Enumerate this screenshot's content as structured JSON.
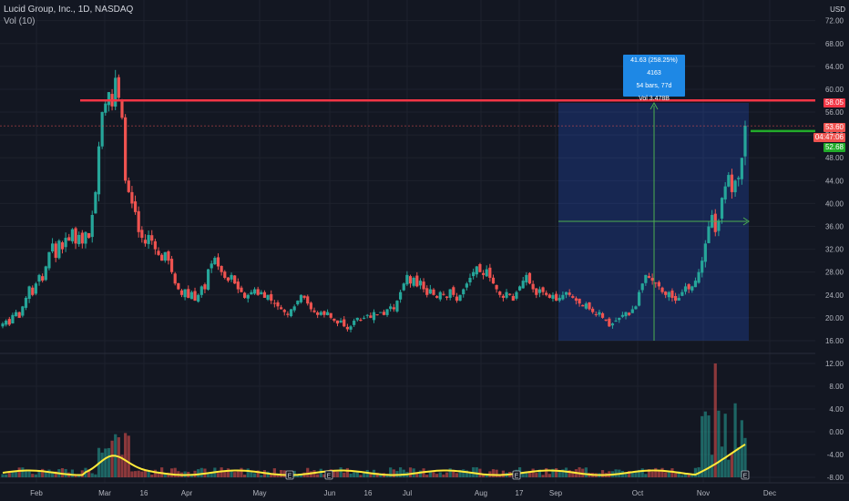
{
  "header": {
    "symbol_line": "Lucid Group, Inc., 1D, NASDAQ",
    "indicator": "Vol (10)",
    "currency": "USD"
  },
  "measure": {
    "line1": "41.63 (258.25%) 4163",
    "line2": "54 bars, 77d",
    "line3": "Vol 3.478B"
  },
  "price_tags": {
    "resistance": "58.05",
    "last": "53.60",
    "countdown": "04:47:06",
    "target": "52.68"
  },
  "chart_data": {
    "type": "candlestick",
    "price_axis_ticks": [
      "72.00",
      "68.00",
      "64.00",
      "60.00",
      "56.00",
      "52.00",
      "48.00",
      "44.00",
      "40.00",
      "36.00",
      "32.00",
      "28.00",
      "24.00",
      "20.00",
      "16.00"
    ],
    "volume_axis_ticks": [
      "12.00",
      "8.00",
      "4.00",
      "0.00",
      "-4.00",
      "-8.00"
    ],
    "x_ticks": [
      "Feb",
      "Mar",
      "16",
      "Apr",
      "May",
      "Jun",
      "16",
      "Jul",
      "Aug",
      "17",
      "Sep",
      "Oct",
      "Nov",
      "Dec"
    ],
    "ylim_price": [
      15,
      74
    ],
    "earnings_markers": [
      "E",
      "E",
      "E",
      "E"
    ],
    "horizontal_levels": {
      "resistance": 58.05,
      "target": 52.68
    },
    "closes": [
      19.0,
      19.5,
      18.8,
      20.5,
      21.0,
      20.0,
      22.0,
      23.5,
      25.5,
      24.0,
      26.0,
      27.5,
      26.5,
      29.0,
      31.5,
      33.0,
      30.5,
      33.5,
      32.0,
      34.0,
      33.5,
      35.5,
      33.0,
      34.5,
      33.0,
      35.0,
      34.0,
      38.0,
      42.0,
      50.0,
      56.0,
      57.5,
      59.5,
      57.0,
      62.0,
      58.5,
      55.0,
      44.0,
      42.0,
      40.0,
      38.5,
      35.0,
      34.0,
      33.0,
      34.5,
      33.5,
      32.0,
      31.0,
      30.0,
      31.5,
      30.0,
      28.0,
      26.0,
      25.0,
      24.0,
      25.0,
      23.5,
      24.5,
      23.0,
      24.0,
      25.5,
      25.0,
      28.5,
      29.5,
      30.5,
      29.0,
      28.0,
      27.0,
      26.5,
      27.5,
      26.0,
      25.0,
      24.5,
      23.5,
      24.0,
      24.5,
      25.0,
      24.0,
      24.5,
      23.5,
      24.0,
      23.0,
      22.5,
      22.0,
      21.5,
      21.0,
      20.5,
      21.5,
      22.0,
      23.0,
      24.0,
      23.5,
      22.5,
      21.5,
      21.0,
      20.5,
      21.0,
      20.5,
      21.0,
      20.0,
      19.5,
      19.0,
      19.5,
      18.5,
      18.0,
      18.5,
      19.5,
      20.0,
      19.5,
      20.0,
      20.5,
      20.0,
      21.0,
      20.5,
      21.0,
      20.5,
      21.5,
      22.0,
      21.5,
      23.0,
      24.5,
      26.0,
      27.5,
      26.0,
      27.0,
      25.5,
      26.5,
      25.0,
      24.0,
      25.0,
      24.0,
      23.5,
      24.5,
      24.0,
      23.5,
      25.0,
      24.0,
      23.0,
      24.0,
      25.0,
      26.0,
      27.0,
      28.0,
      29.0,
      28.0,
      27.5,
      28.5,
      27.0,
      26.0,
      25.0,
      24.0,
      23.5,
      24.5,
      24.0,
      23.0,
      24.5,
      25.5,
      26.5,
      27.5,
      26.0,
      25.0,
      24.0,
      25.0,
      24.5,
      24.0,
      23.5,
      24.0,
      23.0,
      23.5,
      24.0,
      24.5,
      24.0,
      23.5,
      23.0,
      22.5,
      22.0,
      22.5,
      21.5,
      21.0,
      20.5,
      21.0,
      20.0,
      19.5,
      18.5,
      19.0,
      19.5,
      20.0,
      20.5,
      21.0,
      20.5,
      21.5,
      22.0,
      24.5,
      26.0,
      27.5,
      27.0,
      26.5,
      26.0,
      25.5,
      24.5,
      24.0,
      24.5,
      23.5,
      23.0,
      23.5,
      24.5,
      25.5,
      25.0,
      25.5,
      26.5,
      28.0,
      30.0,
      33.0,
      36.0,
      38.0,
      35.0,
      37.0,
      41.0,
      43.0,
      45.0,
      42.0,
      44.0,
      44.5,
      48.0,
      53.6
    ]
  }
}
